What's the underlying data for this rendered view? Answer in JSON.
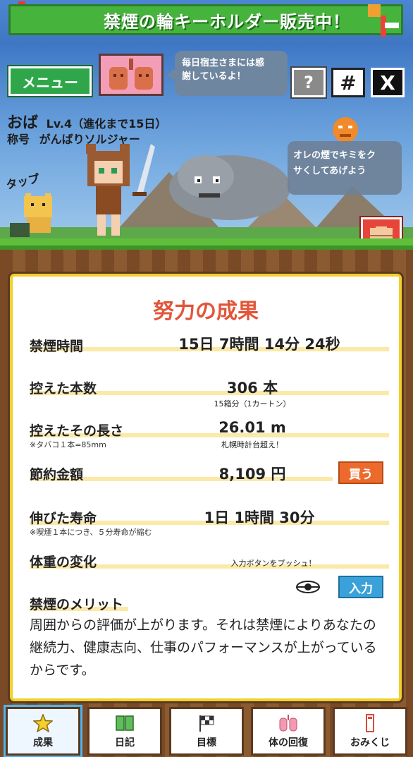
{
  "banner": {
    "text": "禁煙の輪キーホルダー販売中！"
  },
  "hud": {
    "menu_label": "メニュー",
    "help_label": "?",
    "hash_label": "#",
    "x_label": "X",
    "speech_text_line1": "毎日宿主さまには感",
    "speech_text_line2": "謝しているよ！"
  },
  "player": {
    "name": "おば",
    "level": "Lv.4（進化まで15日）",
    "title_prefix": "称号",
    "title": "がんばりソルジャー",
    "tap_label": "タップ"
  },
  "enemy": {
    "speech_line1": "オレの煙でキミをク",
    "speech_line2": "サくしてあげよう"
  },
  "results": {
    "title": "努力の成果",
    "smoke_free_time_label": "禁煙時間",
    "smoke_free_time_value": "15日  7時間  14分  24秒",
    "avoided_count_label": "控えた本数",
    "avoided_count_value": "306 本",
    "avoided_count_sub": "15箱分（1カートン）",
    "avoided_length_label": "控えたその長さ",
    "avoided_length_value": "26.01 m",
    "avoided_length_note": "※タバコ１本=85mm",
    "avoided_length_sub": "札幌時計台超え！",
    "savings_label": "節約金額",
    "savings_value": "8,109 円",
    "buy_label": "買う",
    "life_label": "伸びた寿命",
    "life_value": "1日  1時間  30分",
    "life_note": "※喫煙１本につき、５分寿命が縮む",
    "weight_label": "体重の変化",
    "weight_hint": "入力ボタンをプッシュ！",
    "input_label": "入力",
    "merit_label": "禁煙のメリット",
    "merit_text": "周囲からの評価が上がります。それは禁煙によりあなたの継続力、健康志向、仕事のパフォーマンスが上がっているからです。"
  },
  "nav": {
    "items": [
      {
        "label": "成果",
        "icon": "star-icon",
        "active": true
      },
      {
        "label": "日記",
        "icon": "book-icon",
        "active": false
      },
      {
        "label": "目標",
        "icon": "flag-icon",
        "active": false
      },
      {
        "label": "体の回復",
        "icon": "lungs-icon",
        "active": false
      },
      {
        "label": "おみくじ",
        "icon": "omikuji-icon",
        "active": false
      }
    ]
  },
  "colors": {
    "sky": "#3f78c6",
    "banner_green": "#46b43c",
    "panel_border": "#f2cf2c",
    "title_red": "#e2553a",
    "buy_orange": "#ec6b2c",
    "input_blue": "#3aa2d8"
  }
}
